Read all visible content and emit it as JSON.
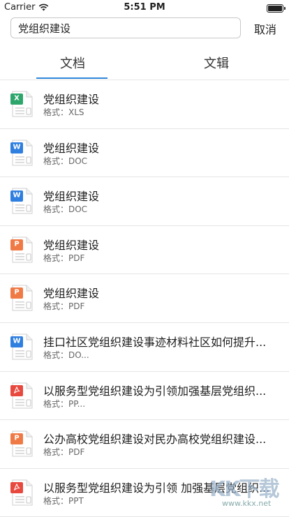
{
  "status_bar": {
    "carrier": "Carrier",
    "time": "5:51 PM"
  },
  "search": {
    "value": "党组织建设",
    "cancel_label": "取消"
  },
  "tabs": [
    {
      "label": "文档",
      "active": true
    },
    {
      "label": "文辑",
      "active": false
    }
  ],
  "results": [
    {
      "title": "党组织建设",
      "meta": "格式：XLS",
      "icon": "xls-file-icon",
      "badge": "X",
      "color": "#2ea66b"
    },
    {
      "title": "党组织建设",
      "meta": "格式：DOC",
      "icon": "doc-file-icon",
      "badge": "W",
      "color": "#2f7fe0"
    },
    {
      "title": "党组织建设",
      "meta": "格式：DOC",
      "icon": "doc-file-icon",
      "badge": "W",
      "color": "#2f7fe0"
    },
    {
      "title": "党组织建设",
      "meta": "格式：PDF",
      "icon": "ppt-file-icon",
      "badge": "P",
      "color": "#f07a45"
    },
    {
      "title": "党组织建设",
      "meta": "格式：PDF",
      "icon": "ppt-file-icon",
      "badge": "P",
      "color": "#f07a45"
    },
    {
      "title": "挂口社区党组织建设事迹材料社区如何提升...",
      "meta": "格式：DO...",
      "icon": "doc-file-icon",
      "badge": "W",
      "color": "#2f7fe0"
    },
    {
      "title": "以服务型党组织建设为引领加强基层党组织...",
      "meta": "格式：PP...",
      "icon": "pdf-file-icon",
      "badge": "pdf",
      "color": "#e8493f"
    },
    {
      "title": "公办高校党组织建设对民办高校党组织建设...",
      "meta": "格式：PDF",
      "icon": "ppt-file-icon",
      "badge": "P",
      "color": "#f07a45"
    },
    {
      "title": "以服务型党组织建设为引领 加强基层党组织...",
      "meta": "格式：PPT",
      "icon": "pdf-file-icon",
      "badge": "pdf",
      "color": "#e8493f"
    }
  ],
  "watermark": {
    "text": "KK下载",
    "url": "www.kkx.net"
  }
}
